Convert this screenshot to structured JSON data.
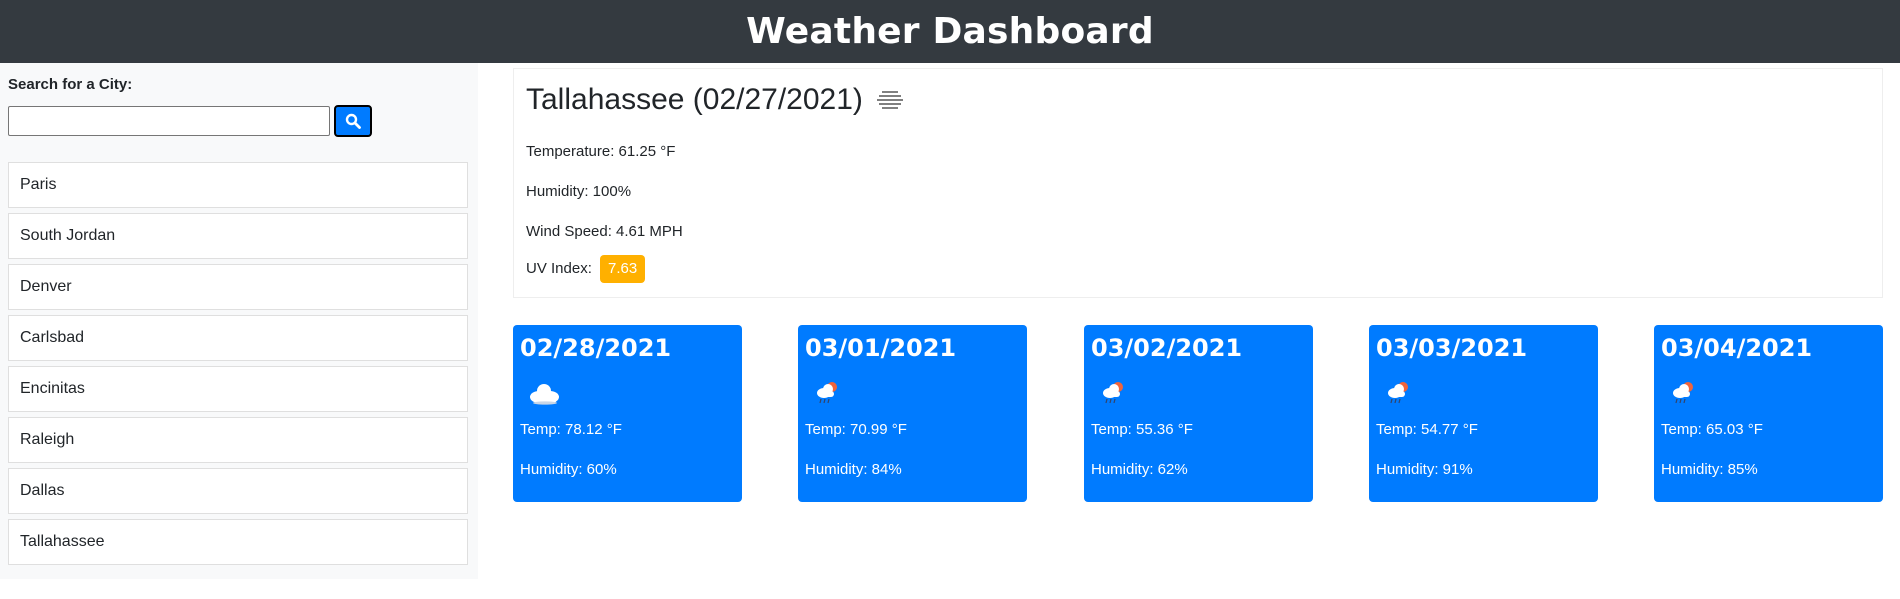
{
  "app": {
    "title": "Weather Dashboard"
  },
  "search": {
    "label": "Search for a City:",
    "value": "",
    "placeholder": "",
    "button_icon": "search-icon"
  },
  "history": [
    "Paris",
    "South Jordan",
    "Denver",
    "Carlsbad",
    "Encinitas",
    "Raleigh",
    "Dallas",
    "Tallahassee"
  ],
  "current": {
    "title": "Tallahassee (02/27/2021)",
    "icon": "mist-icon",
    "temperature": "Temperature: 61.25 °F",
    "humidity": "Humidity: 100%",
    "wind": "Wind Speed: 4.61 MPH",
    "uv_label": "UV Index:",
    "uv_value": "7.63",
    "uv_color": "#ffb000"
  },
  "forecast": [
    {
      "date": "02/28/2021",
      "icon": "cloud-icon",
      "temp": "Temp: 78.12 °F",
      "humidity": "Humidity: 60%"
    },
    {
      "date": "03/01/2021",
      "icon": "sun-cloud-rain-icon",
      "temp": "Temp: 70.99 °F",
      "humidity": "Humidity: 84%"
    },
    {
      "date": "03/02/2021",
      "icon": "sun-cloud-rain-icon",
      "temp": "Temp: 55.36 °F",
      "humidity": "Humidity: 62%"
    },
    {
      "date": "03/03/2021",
      "icon": "sun-cloud-rain-icon",
      "temp": "Temp: 54.77 °F",
      "humidity": "Humidity: 91%"
    },
    {
      "date": "03/04/2021",
      "icon": "sun-cloud-rain-icon",
      "temp": "Temp: 65.03 °F",
      "humidity": "Humidity: 85%"
    }
  ],
  "colors": {
    "header_bg": "#343a40",
    "accent": "#007bff",
    "sidebar_bg": "#f8f9fa",
    "uv_badge": "#ffb000"
  }
}
